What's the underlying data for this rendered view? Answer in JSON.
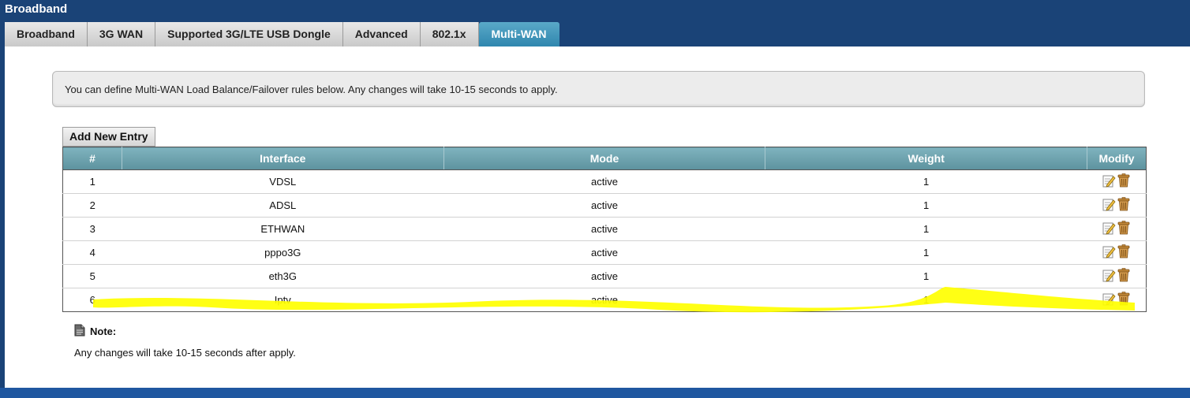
{
  "app": {
    "title": "Broadband"
  },
  "tabs": [
    {
      "label": "Broadband"
    },
    {
      "label": "3G WAN"
    },
    {
      "label": "Supported 3G/LTE USB Dongle"
    },
    {
      "label": "Advanced"
    },
    {
      "label": "802.1x"
    },
    {
      "label": "Multi-WAN",
      "active": true
    }
  ],
  "info": {
    "message": "You can define Multi-WAN Load Balance/Failover rules below. Any changes will take 10-15 seconds to apply."
  },
  "toolbar": {
    "add_label": "Add New Entry"
  },
  "table": {
    "headers": {
      "num": "#",
      "interface": "Interface",
      "mode": "Mode",
      "weight": "Weight",
      "modify": "Modify"
    },
    "rows": [
      {
        "num": "1",
        "interface": "VDSL",
        "mode": "active",
        "weight": "1"
      },
      {
        "num": "2",
        "interface": "ADSL",
        "mode": "active",
        "weight": "1"
      },
      {
        "num": "3",
        "interface": "ETHWAN",
        "mode": "active",
        "weight": "1"
      },
      {
        "num": "4",
        "interface": "pppo3G",
        "mode": "active",
        "weight": "1"
      },
      {
        "num": "5",
        "interface": "eth3G",
        "mode": "active",
        "weight": "1"
      },
      {
        "num": "6",
        "interface": "Iptv",
        "mode": "active",
        "weight": "1",
        "highlighted": true
      }
    ],
    "icons": {
      "edit": "edit-icon",
      "delete": "trash-icon"
    }
  },
  "note": {
    "title": "Note:",
    "text": "Any changes will take 10-15 seconds after apply."
  },
  "colors": {
    "header_bg": "#1a4377",
    "active_tab": "#3a8fb6",
    "table_header": "#6ea3ae",
    "highlight": "#ffff00"
  }
}
